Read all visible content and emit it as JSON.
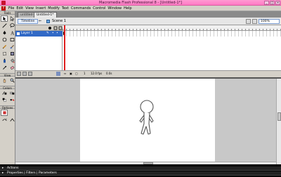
{
  "window": {
    "title": "Macromedia Flash Professional 8 - [Untitled-1*]",
    "controls": [
      "_",
      "□",
      "×"
    ]
  },
  "menubar": {
    "items": [
      "File",
      "Edit",
      "View",
      "Insert",
      "Modify",
      "Text",
      "Commands",
      "Control",
      "Window",
      "Help"
    ]
  },
  "toolbox": {
    "header": "Tools",
    "view_label": "View",
    "colors_label": "Colors",
    "options_label": "Options",
    "tools": [
      "selection-tool",
      "subselection-tool",
      "line-tool",
      "lasso-tool",
      "pen-tool",
      "text-tool",
      "oval-tool",
      "rectangle-tool",
      "pencil-tool",
      "brush-tool",
      "free-transform-tool",
      "fill-transform-tool",
      "ink-bottle-tool",
      "paint-bucket-tool",
      "eyedropper-tool",
      "eraser-tool"
    ]
  },
  "doc_tabs": {
    "inactive": "untitled-1",
    "active": "Untitled-1*"
  },
  "scene": {
    "timeline_button": "Timeline",
    "scene_label": "Scene 1",
    "zoom": "100%"
  },
  "layers": {
    "name": "Layer 1"
  },
  "frame_footer": {
    "current_frame": "1",
    "fps": "12.0 fps",
    "elapsed": "0.0s"
  },
  "panels": [
    "Actions",
    "Properties | Filters | Parameters"
  ]
}
